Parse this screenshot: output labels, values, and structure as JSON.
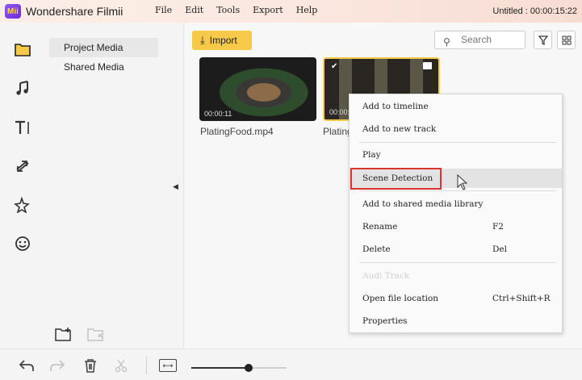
{
  "titlebar": {
    "logo_text": "Mii",
    "app_name": "Wondershare Filmii",
    "menu": [
      "File",
      "Edit",
      "Tools",
      "Export",
      "Help"
    ],
    "project_name": "Untitled :",
    "timecode": "00:00:15:22"
  },
  "rail_icons": [
    "folder-icon",
    "music-note-icon",
    "text-icon",
    "transition-icon",
    "effects-sparkle-icon",
    "sticker-smiley-icon"
  ],
  "left_panel": {
    "items": [
      {
        "label": "Project Media",
        "active": true
      },
      {
        "label": "Shared Media",
        "active": false
      }
    ]
  },
  "toolbar": {
    "import_label": "Import",
    "search_placeholder": "Search"
  },
  "media": [
    {
      "name": "PlatingFood.mp4",
      "duration": "00:00:11",
      "selected": false
    },
    {
      "name": "Plating",
      "duration": "00:00:",
      "selected": true
    }
  ],
  "context_menu": {
    "items": [
      {
        "label": "Add to timeline",
        "shortcut": ""
      },
      {
        "label": "Add to new track",
        "shortcut": ""
      },
      {
        "label": "Play",
        "shortcut": ""
      },
      {
        "label": "Scene Detection",
        "shortcut": ""
      },
      {
        "label": "Add to shared media library",
        "shortcut": ""
      },
      {
        "label": "Rename",
        "shortcut": "F2"
      },
      {
        "label": "Delete",
        "shortcut": "Del"
      },
      {
        "label": "Audi Track",
        "shortcut": ""
      },
      {
        "label": "Open file location",
        "shortcut": "Ctrl+Shift+R"
      },
      {
        "label": "Properties",
        "shortcut": ""
      }
    ],
    "highlighted_index": 3,
    "disabled_index": 7
  },
  "zoom": {
    "level": 0.6
  },
  "colors": {
    "accent": "#f7c948",
    "highlight_box": "#d9362b"
  }
}
